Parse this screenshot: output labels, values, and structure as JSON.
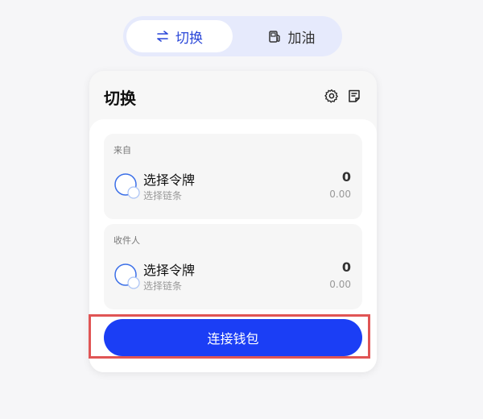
{
  "nav": {
    "tabs": [
      {
        "label": "切换",
        "icon": "swap-arrows-icon"
      },
      {
        "label": "加油",
        "icon": "fuel-pump-icon"
      }
    ],
    "active_color": "#2a47d8",
    "bg_color": "#e6eafc"
  },
  "card": {
    "title": "切换",
    "settings_icon": "gear-icon",
    "history_icon": "document-icon"
  },
  "from": {
    "label": "来自",
    "token": "选择令牌",
    "chain": "选择链条",
    "amount": "0",
    "usd": "0.00"
  },
  "to": {
    "label": "收件人",
    "token": "选择令牌",
    "chain": "选择链条",
    "amount": "0",
    "usd": "0.00"
  },
  "connect_button": {
    "label": "连接钱包",
    "color": "#1b3ef5"
  },
  "highlight_color": "#e05555"
}
